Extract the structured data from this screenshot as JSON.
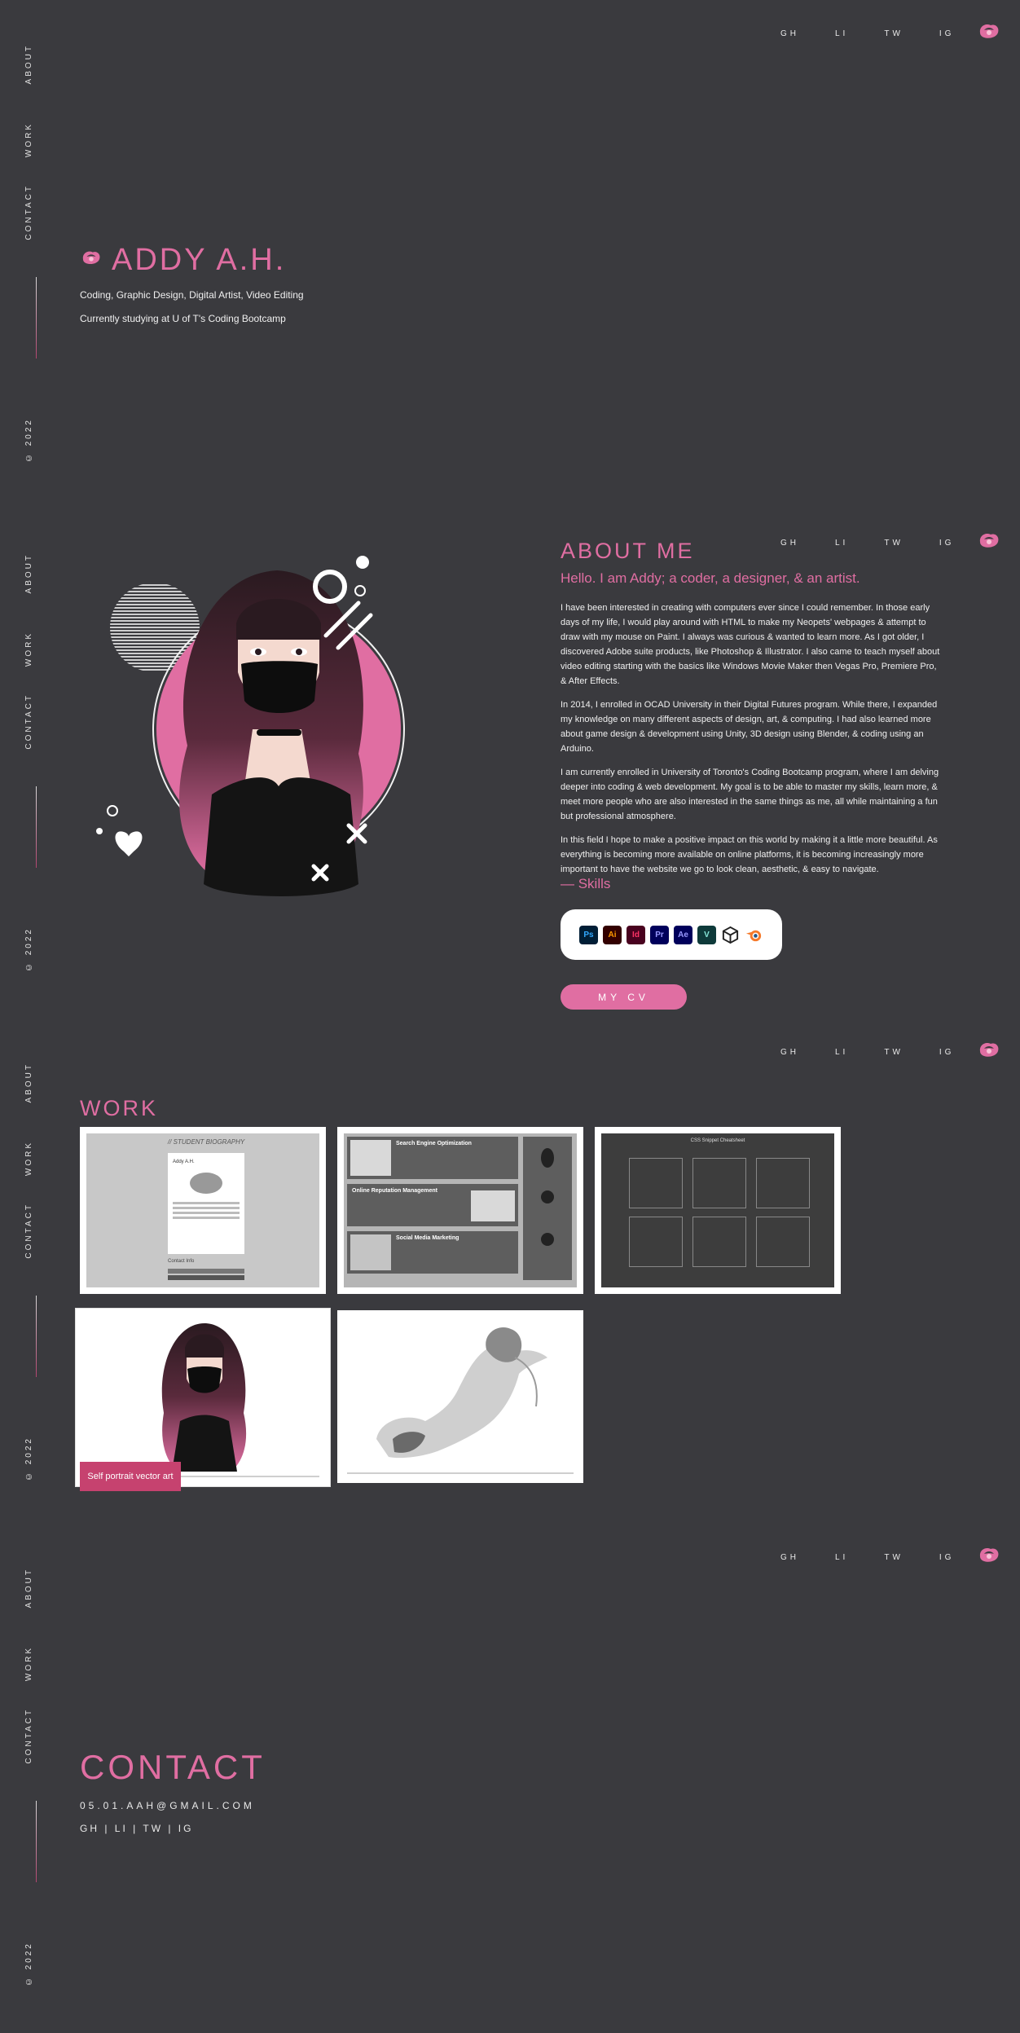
{
  "nav": {
    "top_links": [
      "GH",
      "LI",
      "TW",
      "IG"
    ],
    "side_about": "ABOUT",
    "side_work": "WORK",
    "side_contact": "CONTACT",
    "side_copyright": "© 2022"
  },
  "hero": {
    "name": "ADDY A.H.",
    "tagline": "Coding, Graphic Design, Digital Artist, Video Editing",
    "status": "Currently studying at U of T's Coding Bootcamp"
  },
  "about": {
    "title": "ABOUT ME",
    "hello": "Hello. I am Addy; a coder, a designer, & an artist.",
    "p1": "I have been interested in creating with computers ever since I could remember. In those early days of my life, I would play around with HTML to make my Neopets' webpages & attempt to draw with my mouse on Paint. I always was curious & wanted to learn more. As I got older, I discovered Adobe suite products, like Photoshop & Illustrator. I also came to teach myself about video editing starting with the basics like Windows Movie Maker then Vegas Pro, Premiere Pro, & After Effects.",
    "p2": "In 2014, I enrolled in OCAD University in their Digital Futures program. While there, I expanded my knowledge on many different aspects of design, art, & computing. I had also learned more about game design & development using Unity, 3D design using Blender, & coding using an Arduino.",
    "p3": "I am currently enrolled in University of Toronto's Coding Bootcamp program, where I am delving deeper into coding & web development. My goal is to be able to master my skills, learn more, & meet more people who are also interested in the same things as me, all while maintaining a fun but professional atmosphere.",
    "p4": "In this field I hope to make a positive impact on this world by making it a little more beautiful. As everything is becoming more available on online platforms, it is becoming increasingly more important to have the website we go to look clean, aesthetic, & easy to navigate.",
    "skills_title": "— Skills",
    "skills": [
      {
        "label": "Ps",
        "bg": "#001e36",
        "fg": "#31a8ff"
      },
      {
        "label": "Ai",
        "bg": "#330000",
        "fg": "#ff9a00"
      },
      {
        "label": "Id",
        "bg": "#49021f",
        "fg": "#ff3366"
      },
      {
        "label": "Pr",
        "bg": "#00005b",
        "fg": "#9999ff"
      },
      {
        "label": "Ae",
        "bg": "#00005b",
        "fg": "#9999ff"
      },
      {
        "label": "V",
        "bg": "#0e3a3a",
        "fg": "#86e6d8"
      }
    ],
    "cv_button": "MY CV"
  },
  "work": {
    "title": "WORK",
    "card1_heading": "// STUDENT BIOGRAPHY",
    "card1_name": "Addy A.H.",
    "card1_contact": "Contact Info",
    "card2_items": [
      "Search Engine Optimization",
      "Online Reputation Management",
      "Social Media Marketing"
    ],
    "card3_heading": "CSS Snippet Cheatsheet",
    "caption": "Self portrait vector art"
  },
  "contact": {
    "title": "CONTACT",
    "email": "05.01.AAH@GMAIL.COM",
    "links": "GH | LI | TW | IG"
  },
  "colors": {
    "background": "#3a3a3e",
    "accent": "#e06ea2"
  }
}
